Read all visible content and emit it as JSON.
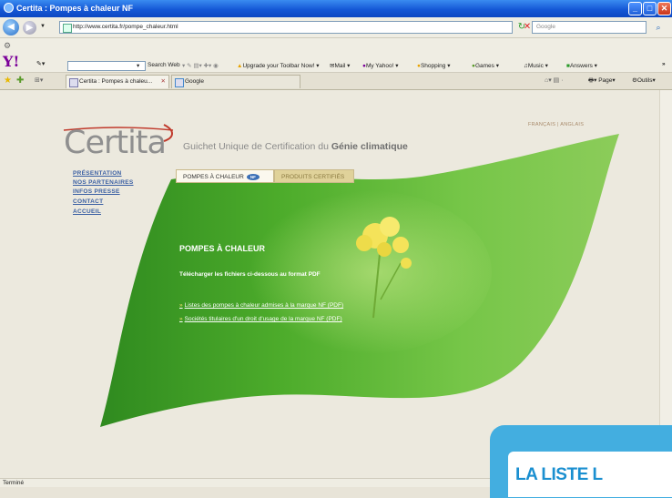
{
  "window": {
    "title": "Certita : Pompes à chaleur NF"
  },
  "nav": {
    "url": "http://www.certita.fr/pompe_chaleur.html",
    "search_placeholder": "Google"
  },
  "yahoo_toolbar": {
    "search_label": "Search Web",
    "items": [
      "Upgrade your Toolbar Now!",
      "Mail",
      "My Yahoo!",
      "Shopping",
      "Games",
      "Music",
      "Answers"
    ],
    "overflow": "»"
  },
  "tabs": [
    {
      "label": "Certita : Pompes à chaleu..."
    },
    {
      "label": "Google"
    }
  ],
  "bookmarks_right": {
    "page": "Page",
    "tools": "Outils"
  },
  "site": {
    "logo": "Certita",
    "tagline_pre": "Guichet Unique de Certification du ",
    "tagline_bold": "Génie climatique",
    "lang": "FRANÇAIS | ANGLAIS",
    "menu": [
      "PRÉSENTATION",
      "NOS PARTENAIRES",
      "INFOS PRESSE",
      "CONTACT",
      "ACCUEIL"
    ],
    "product_tabs": {
      "heat_pumps": "POMPES À CHALEUR",
      "nf_badge": "NF",
      "certified": "PRODUITS CERTIFIÉS"
    },
    "section_title": "POMPES À CHALEUR",
    "section_subtitle": "Télécharger les fichiers ci-dessous au format PDF",
    "links": [
      "Listes des pompes à chaleur admises à la marque NF (PDF)",
      "Sociétés titulaires d'un droit d'usage de la marque NF (PDF)"
    ]
  },
  "status": {
    "text": "Terminé"
  },
  "banner": {
    "text": "LA LISTE L"
  },
  "colors": {
    "title_blue": "#1558d6",
    "banner_blue": "#43aee0",
    "wave_green": "#3fa12a"
  }
}
